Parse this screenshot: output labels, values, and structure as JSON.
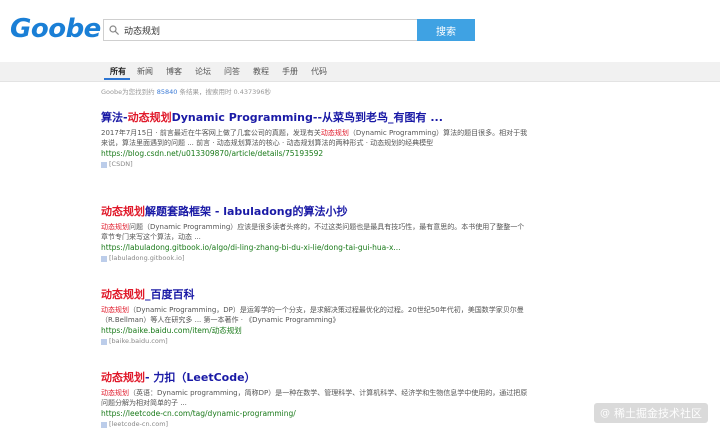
{
  "brand": {
    "logo": "Goobe"
  },
  "search": {
    "query": "动态规划",
    "button_label": "搜索"
  },
  "nav": {
    "tabs": [
      {
        "label": "所有",
        "active": true
      },
      {
        "label": "新闻",
        "active": false
      },
      {
        "label": "博客",
        "active": false
      },
      {
        "label": "论坛",
        "active": false
      },
      {
        "label": "问答",
        "active": false
      },
      {
        "label": "教程",
        "active": false
      },
      {
        "label": "手册",
        "active": false
      },
      {
        "label": "代码",
        "active": false
      }
    ]
  },
  "stats": {
    "prefix": "Goobe为您找到约",
    "count": "85840",
    "suffix": "条结果，搜索用时 0.437396秒"
  },
  "results": [
    {
      "title_pre": "算法-",
      "title_hl": "动态规划",
      "title_post": "Dynamic Programming--从菜鸟到老鸟_有图有 ...",
      "snippet_pre": "2017年7月15日 · 前言最近在牛客网上做了几套公司的真题，发现有关",
      "snippet_hl": "动态规划",
      "snippet_post": "（Dynamic Programming）算法的题目很多。相对于我来说，算法里面遇到的问题 ... 前言 · 动态规划算法的核心 · 动态规划算法的两种形式 · 动态规划的经典模型",
      "url": "https://blog.csdn.net/u013309870/article/details/75193592",
      "source": "[CSDN]"
    },
    {
      "title_pre": "",
      "title_hl": "动态规划",
      "title_post": "解题套路框架 - labuladong的算法小抄",
      "snippet_pre": "",
      "snippet_hl": "动态规划",
      "snippet_post": "问题（Dynamic Programming）应该是很多读者头疼的，不过这类问题也是最具有技巧性，最有意思的。本书使用了整整一个章节专门来写这个算法，动态 ...",
      "url": "https://labuladong.gitbook.io/algo/di-ling-zhang-bi-du-xi-lie/dong-tai-gui-hua-x...",
      "source": "[labuladong.gitbook.io]"
    },
    {
      "title_pre": "",
      "title_hl": "动态规划",
      "title_post": "_百度百科",
      "snippet_pre": "",
      "snippet_hl": "动态规划",
      "snippet_post": "（Dynamic Programming，DP）是运筹学的一个分支，是求解决策过程最优化的过程。20世纪50年代初，美国数学家贝尔曼（R.Bellman）等人在研究多 ... 第一本著作 · 《Dynamic Programming》",
      "url": "https://baike.baidu.com/item/动态规划",
      "source": "[baike.baidu.com]"
    },
    {
      "title_pre": "",
      "title_hl": "动态规划",
      "title_post": "- 力扣（LeetCode）",
      "snippet_pre": "",
      "snippet_hl": "动态规划",
      "snippet_post": "（英语：Dynamic programming，简称DP）是一种在数学、管理科学、计算机科学、经济学和生物信息学中使用的，通过把原问题分解为相对简单的子 ...",
      "url": "https://leetcode-cn.com/tag/dynamic-programming/",
      "source": "[leetcode-cn.com]"
    }
  ],
  "watermark": {
    "text": "稀土掘金技术社区"
  },
  "colors": {
    "accent": "#3fa2e3",
    "logo": "#1a7fd6",
    "title_link": "#1a1aa6",
    "highlight": "#e0192a",
    "url": "#1a7a1a"
  }
}
